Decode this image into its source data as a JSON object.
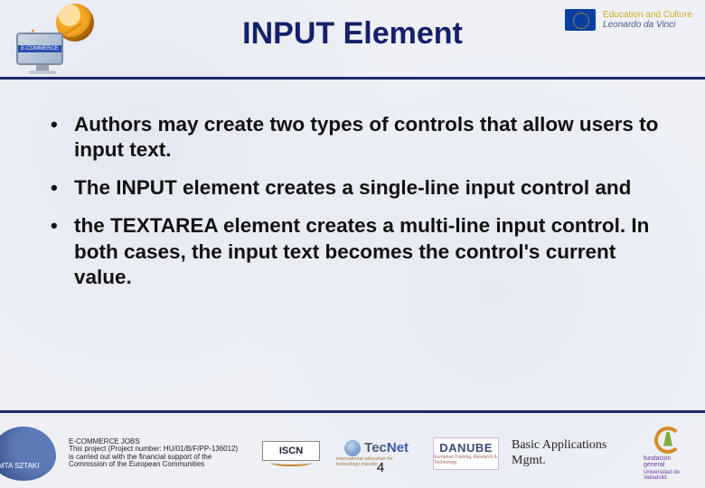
{
  "header": {
    "title": "INPUT Element",
    "monitor_tag": "E-COMMERCE",
    "edu_culture_line1": "Education and Culture",
    "edu_culture_line2": "Leonardo da Vinci"
  },
  "bullets": [
    "Authors may create two types of controls that allow users to input text.",
    "The INPUT element creates a single-line input control and",
    "the TEXTAREA element creates a multi-line input control. In both cases, the input text becomes the control's current value."
  ],
  "footer": {
    "sztaki_label": "MTA SZTAKI",
    "disclaimer_title": "E-COMMERCE JOBS",
    "disclaimer_line2": "This project (Project number: HU/01/B/F/PP-136012)",
    "disclaimer_line3": "is carried out with the financial support of the Commssion of the European Communities",
    "iscn_label": "ISCN",
    "tecnet_tec": "Tec",
    "tecnet_net": "Net",
    "tecnet_sub": "international education for technology transfer",
    "danube_label": "DANUBE",
    "danube_sub": "European Training, Research & Technology",
    "page_number": "4",
    "right_text": "Basic Applications Mgmt.",
    "fund_line1": "fundación general",
    "fund_line2": "Universidad de Valladolid"
  }
}
